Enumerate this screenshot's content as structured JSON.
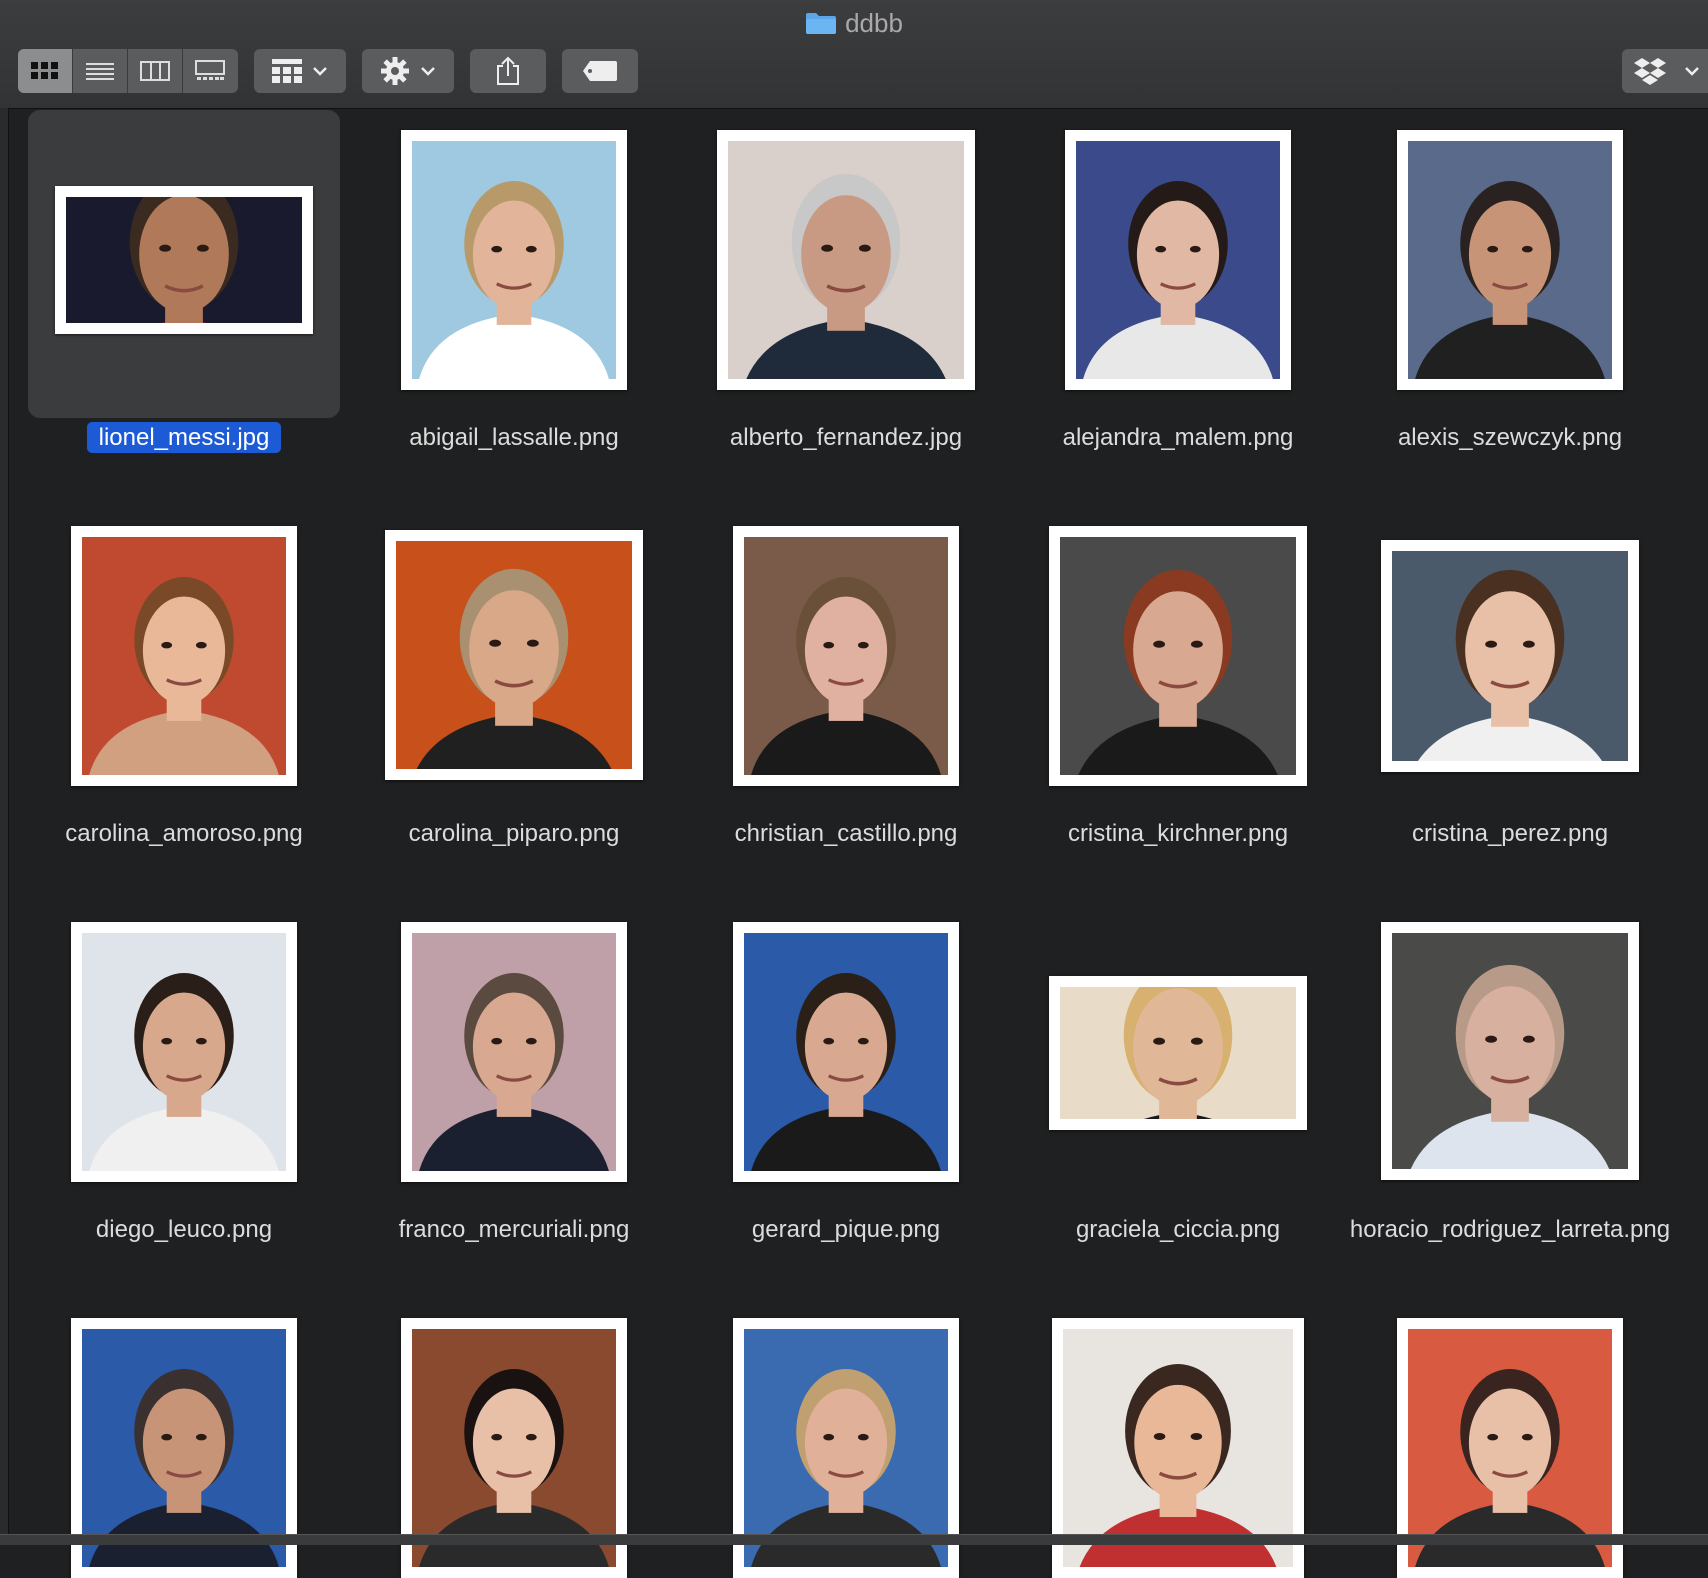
{
  "window": {
    "title": "ddbb"
  },
  "toolbar": {
    "view_modes": [
      {
        "icon": "icon-view-icon",
        "active": true
      },
      {
        "icon": "list-view-icon",
        "active": false
      },
      {
        "icon": "column-view-icon",
        "active": false
      },
      {
        "icon": "gallery-view-icon",
        "active": false
      }
    ],
    "group_icon": "group-by-icon",
    "action_icon": "gear-icon",
    "share_icon": "share-icon",
    "tag_icon": "tag-icon",
    "dropbox_icon": "dropbox-icon"
  },
  "files": [
    {
      "name": "lionel_messi.jpg",
      "selected": true,
      "bg": "#1a1a2e",
      "skin": "#b07a5a",
      "hair": "#3a2a20",
      "shirt": "#a01b3c"
    },
    {
      "name": "abigail_lassalle.png",
      "selected": false,
      "bg": "#9fc9e0",
      "skin": "#e2b59a",
      "hair": "#b89a6a",
      "shirt": "#ffffff"
    },
    {
      "name": "alberto_fernandez.jpg",
      "selected": false,
      "bg": "#d9d0cc",
      "skin": "#c89a84",
      "hair": "#c8c8c8",
      "shirt": "#1f2a3a"
    },
    {
      "name": "alejandra_malem.png",
      "selected": false,
      "bg": "#3a4a8a",
      "skin": "#e0b8a4",
      "hair": "#241a18",
      "shirt": "#e8e8e8"
    },
    {
      "name": "alexis_szewczyk.png",
      "selected": false,
      "bg": "#5a6a8a",
      "skin": "#c89478",
      "hair": "#2a2220",
      "shirt": "#202020"
    },
    {
      "name": "carolina_amoroso.png",
      "selected": false,
      "bg": "#c04a30",
      "skin": "#e8b898",
      "hair": "#7a4a28",
      "shirt": "#d0a080"
    },
    {
      "name": "carolina_piparo.png",
      "selected": false,
      "bg": "#c8501a",
      "skin": "#d8a888",
      "hair": "#a89070",
      "shirt": "#202020"
    },
    {
      "name": "christian_castillo.png",
      "selected": false,
      "bg": "#7a5a48",
      "skin": "#e0b0a0",
      "hair": "#6a5038",
      "shirt": "#1a1a1a"
    },
    {
      "name": "cristina_kirchner.png",
      "selected": false,
      "bg": "#4a4a4a",
      "skin": "#d8a890",
      "hair": "#8a3a20",
      "shirt": "#1a1a1a"
    },
    {
      "name": "cristina_perez.png",
      "selected": false,
      "bg": "#4a5a6a",
      "skin": "#e8c0a8",
      "hair": "#4a3020",
      "shirt": "#f0f0f0"
    },
    {
      "name": "diego_leuco.png",
      "selected": false,
      "bg": "#dfe4ea",
      "skin": "#d8a88c",
      "hair": "#2a1e18",
      "shirt": "#f0f0f0"
    },
    {
      "name": "franco_mercuriali.png",
      "selected": false,
      "bg": "#c0a0a8",
      "skin": "#d8a890",
      "hair": "#5a4a40",
      "shirt": "#1a2030"
    },
    {
      "name": "gerard_pique.png",
      "selected": false,
      "bg": "#2a5aa8",
      "skin": "#d8a890",
      "hair": "#2a2018",
      "shirt": "#1a1a1a"
    },
    {
      "name": "graciela_ciccia.png",
      "selected": false,
      "bg": "#e8dcc8",
      "skin": "#e0b898",
      "hair": "#d8b070",
      "shirt": "#1a1a1a"
    },
    {
      "name": "horacio_rodriguez_larreta.png",
      "selected": false,
      "bg": "#4a4a48",
      "skin": "#d8b0a0",
      "hair": "#b89a88",
      "shirt": "#dde4ee"
    },
    {
      "name": "",
      "selected": false,
      "bg": "#2a5aa8",
      "skin": "#c89478",
      "hair": "#3a3030",
      "shirt": "#1a2030"
    },
    {
      "name": "",
      "selected": false,
      "bg": "#8a4a30",
      "skin": "#e8c0a8",
      "hair": "#1a1210",
      "shirt": "#2a2a2a"
    },
    {
      "name": "",
      "selected": false,
      "bg": "#3a6ab0",
      "skin": "#e0b098",
      "hair": "#c0a070",
      "shirt": "#2a2a2a"
    },
    {
      "name": "",
      "selected": false,
      "bg": "#e8e4e0",
      "skin": "#e8b898",
      "hair": "#3a2820",
      "shirt": "#c03030"
    },
    {
      "name": "",
      "selected": false,
      "bg": "#d85a40",
      "skin": "#e8c0a8",
      "hair": "#3a2420",
      "shirt": "#2a2a2a"
    }
  ],
  "accent": "#1d5bd6"
}
